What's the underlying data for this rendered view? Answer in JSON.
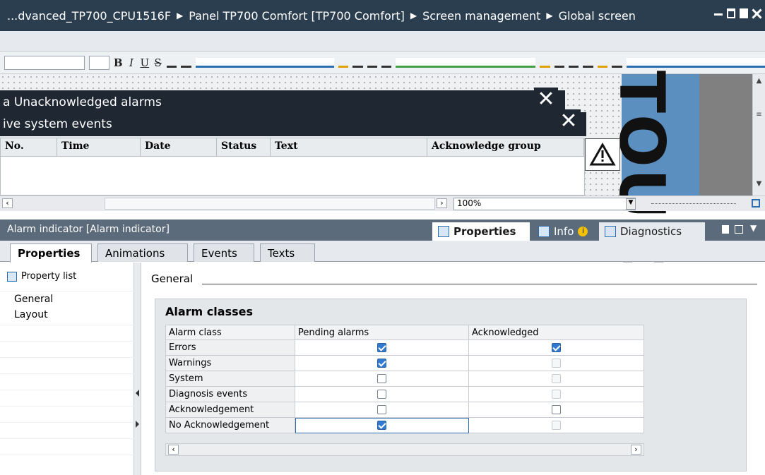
{
  "titlebar": {
    "crumbs": [
      "...dvanced_TP700_CPU1516F",
      "Panel TP700 Comfort [TP700 Comfort]",
      "Screen management",
      "Global screen"
    ]
  },
  "toolbar": {
    "bold": "B",
    "italic": "I",
    "underline": "U",
    "strike": "S"
  },
  "editor": {
    "alarm_bar_1": "a Unacknowledged alarms",
    "alarm_bar_2": "ive system events",
    "columns": [
      "No.",
      "Time",
      "Date",
      "Status",
      "Text",
      "Acknowledge group"
    ],
    "touch_text": "TOUC",
    "zoom": "100%"
  },
  "inspector": {
    "title": "Alarm indicator [Alarm indicator]",
    "tabs": [
      "Properties",
      "Info",
      "Diagnostics"
    ],
    "subtabs": [
      "Properties",
      "Animations",
      "Events",
      "Texts"
    ],
    "property_list": "Property list",
    "nav": [
      "General",
      "Layout"
    ],
    "section": "General",
    "panel_title": "Alarm classes",
    "table": {
      "headers": [
        "Alarm class",
        "Pending alarms",
        "Acknowledged"
      ],
      "rows": [
        {
          "name": "Errors",
          "pending": true,
          "acknowledged": true,
          "ack_enabled": true
        },
        {
          "name": "Warnings",
          "pending": true,
          "acknowledged": false,
          "ack_enabled": false
        },
        {
          "name": "System",
          "pending": false,
          "acknowledged": false,
          "ack_enabled": false
        },
        {
          "name": "Diagnosis events",
          "pending": false,
          "acknowledged": false,
          "ack_enabled": false
        },
        {
          "name": "Acknowledgement",
          "pending": false,
          "acknowledged": false,
          "ack_enabled": true
        },
        {
          "name": "No Acknowledgement",
          "pending": true,
          "acknowledged": false,
          "ack_enabled": false
        }
      ]
    }
  }
}
